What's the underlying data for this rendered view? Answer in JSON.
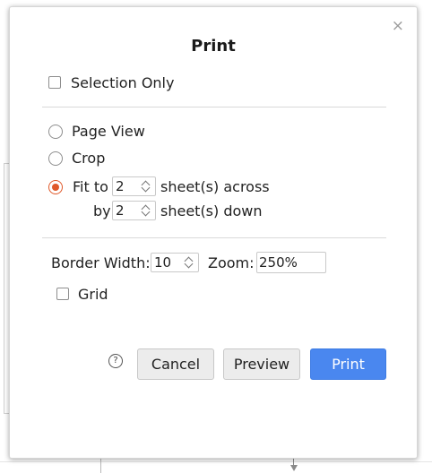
{
  "dialog": {
    "title": "Print",
    "close_glyph": "×"
  },
  "options": {
    "selection_only_label": "Selection Only",
    "selection_only_checked": false,
    "page_view_label": "Page View",
    "crop_label": "Crop",
    "fit_to_label": "Fit to",
    "fit_across_value": "2",
    "sheets_across_label": "sheet(s) across",
    "by_label": "by",
    "fit_down_value": "2",
    "sheets_down_label": "sheet(s) down",
    "selected_mode": "Fit to"
  },
  "layout": {
    "border_width_label": "Border Width:",
    "border_width_value": "10",
    "zoom_label": "Zoom:",
    "zoom_value": "250%",
    "grid_label": "Grid",
    "grid_checked": false
  },
  "buttons": {
    "help_glyph": "?",
    "cancel_label": "Cancel",
    "preview_label": "Preview",
    "print_label": "Print"
  },
  "colors": {
    "accent_radio": "#e0592a",
    "primary_button": "#4a87ef"
  }
}
